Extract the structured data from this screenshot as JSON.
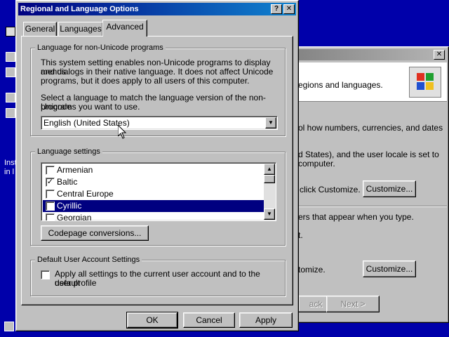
{
  "desktop": {
    "side_text_1": "Inst",
    "side_text_2": "in l"
  },
  "back_window": {
    "lines": [
      "egions and languages.",
      "ol how numbers, currencies, and dates",
      "d States), and the user locale is set to",
      "computer.",
      "click Customize.",
      "ers that appear when you type.",
      "t.",
      "tomize."
    ],
    "customize_label_1": "Customize...",
    "customize_label_2": "Customize...",
    "back_label": "ack",
    "next_label": "Next >"
  },
  "dialog": {
    "title": "Regional and Language Options",
    "help_glyph": "?",
    "close_glyph": "✕",
    "tabs": [
      {
        "label": "General",
        "active": false
      },
      {
        "label": "Languages",
        "active": false
      },
      {
        "label": "Advanced",
        "active": true
      }
    ],
    "non_unicode": {
      "title": "Language for non-Unicode programs",
      "desc_lines": [
        "This system setting enables non-Unicode programs to display menus",
        "and dialogs in their native language. It does not affect Unicode",
        "programs, but it does apply to all users of this computer."
      ],
      "prompt_lines": [
        "Select a language to match the language version of the non-Unicode",
        "programs you want to use."
      ],
      "selected_language": "English (United States)"
    },
    "language_settings": {
      "title": "Language settings",
      "items": [
        {
          "label": "Armenian",
          "checked": false,
          "selected": false
        },
        {
          "label": "Baltic",
          "checked": true,
          "selected": false
        },
        {
          "label": "Central Europe",
          "checked": false,
          "selected": false
        },
        {
          "label": "Cyrillic",
          "checked": true,
          "selected": true
        },
        {
          "label": "Georgian",
          "checked": false,
          "selected": false
        }
      ],
      "codepage_button": "Codepage conversions..."
    },
    "default_user": {
      "title": "Default User Account Settings",
      "checkbox_lines": [
        "Apply all settings to the current user account and to the default",
        "user profile"
      ],
      "checked": false
    },
    "buttons": {
      "ok": "OK",
      "cancel": "Cancel",
      "apply": "Apply"
    }
  },
  "colors": {
    "desktop": "#0000aa",
    "face": "#c0c0c0",
    "title_active": "#000080",
    "selection": "#000080"
  }
}
